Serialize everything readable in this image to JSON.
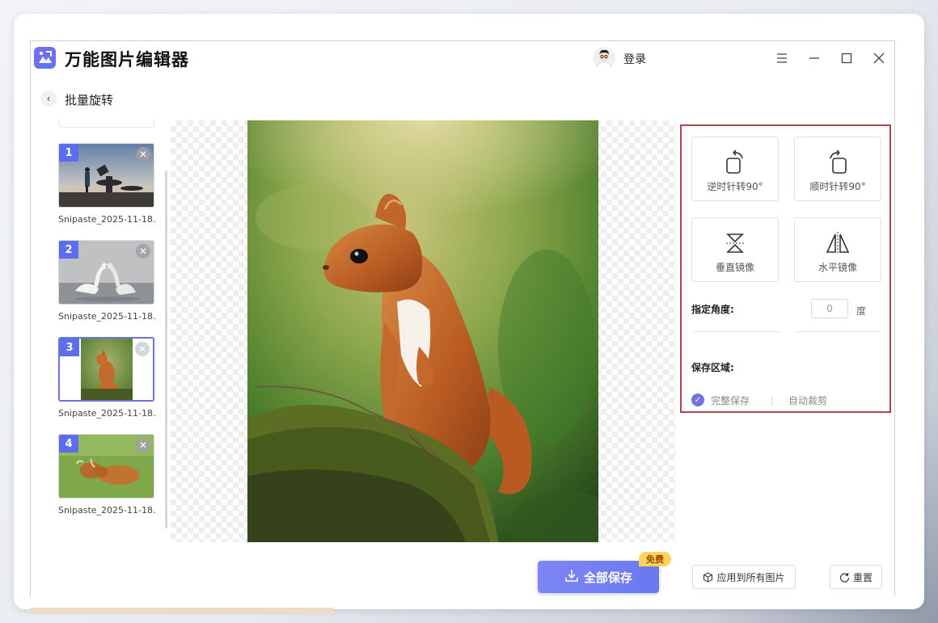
{
  "app": {
    "title": "万能图片编辑器",
    "login_label": "登录"
  },
  "window_controls": {
    "menu_icon": "menu-icon",
    "minimize_icon": "minimize-icon",
    "maximize_icon": "maximize-icon",
    "close_icon": "close-icon"
  },
  "breadcrumb": {
    "title": "批量旋转"
  },
  "thumbnails": [
    {
      "number": "1",
      "name": "Snipaste_2025-11-18...",
      "image": "figures-on-wall-at-sunset"
    },
    {
      "number": "2",
      "name": "Snipaste_2025-11-18...",
      "image": "two-swans"
    },
    {
      "number": "3",
      "name": "Snipaste_2025-11-18...",
      "image": "squirrel",
      "selected": true
    },
    {
      "number": "4",
      "name": "Snipaste_2025-11-18...",
      "image": "highland-cattle-on-grass"
    }
  ],
  "preview": {
    "image": "red-squirrel-on-mossy-stump"
  },
  "panel": {
    "rotate_ccw_label": "逆时针转90°",
    "rotate_cw_label": "顺时针转90°",
    "flip_vertical_label": "垂直镜像",
    "flip_horizontal_label": "水平镜像",
    "angle_label": "指定角度:",
    "angle_value": "0",
    "angle_unit": "度",
    "save_area_label": "保存区域:",
    "option_full_save": "完整保存",
    "option_auto_crop": "自动裁剪",
    "selected_option": "完整保存"
  },
  "actions": {
    "save_all_label": "全部保存",
    "free_badge": "免费",
    "apply_all_label": "应用到所有图片",
    "reset_label": "重置"
  },
  "colors": {
    "accent": "#6a79f0",
    "panel_border": "#b0454f",
    "badge": "#ffd25a"
  }
}
